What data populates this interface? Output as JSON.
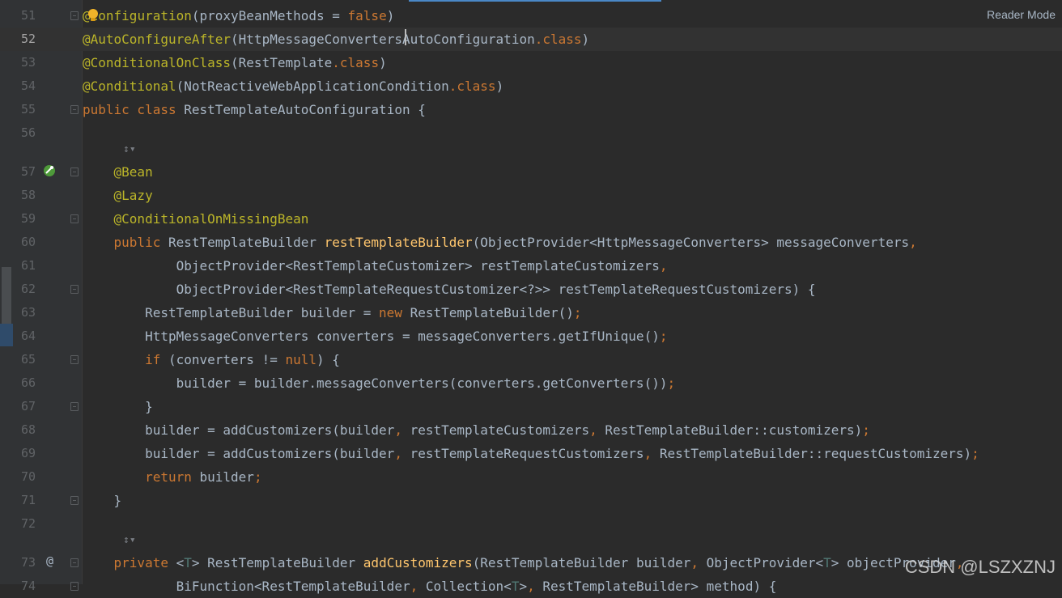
{
  "toolbar": {
    "reader_mode": "Reader Mode"
  },
  "watermark": "CSDN @LSZXZNJ",
  "inlay_hint": "↕▾",
  "colors": {
    "background": "#2b2b2b",
    "keyword": "#cc7832",
    "annotation": "#bbb529",
    "method_decl": "#ffc66d",
    "text": "#a9b7c6",
    "line_number": "#606366"
  },
  "lines": [
    {
      "num": "51",
      "segments": [
        {
          "t": "@",
          "c": "ann"
        },
        {
          "t": "Configuration",
          "c": "ann"
        },
        {
          "t": "(proxyBeanMethods = "
        },
        {
          "t": "false",
          "c": "kw"
        },
        {
          "t": ")"
        }
      ]
    },
    {
      "num": "52",
      "segments": [
        {
          "t": "@AutoConfigureAfter",
          "c": "ann"
        },
        {
          "t": "(HttpMessageConvertersAutoConfiguration"
        },
        {
          "t": ".",
          "c": "pun"
        },
        {
          "t": "class",
          "c": "kw"
        },
        {
          "t": ")"
        }
      ]
    },
    {
      "num": "53",
      "segments": [
        {
          "t": "@ConditionalOnClass",
          "c": "ann"
        },
        {
          "t": "(RestTemplate"
        },
        {
          "t": ".",
          "c": "pun"
        },
        {
          "t": "class",
          "c": "kw"
        },
        {
          "t": ")"
        }
      ]
    },
    {
      "num": "54",
      "segments": [
        {
          "t": "@Conditional",
          "c": "ann"
        },
        {
          "t": "(NotReactiveWebApplicationCondition"
        },
        {
          "t": ".",
          "c": "pun"
        },
        {
          "t": "class",
          "c": "kw"
        },
        {
          "t": ")"
        }
      ]
    },
    {
      "num": "55",
      "segments": [
        {
          "t": "public class ",
          "c": "kw"
        },
        {
          "t": "RestTemplateAutoConfiguration {"
        }
      ]
    },
    {
      "num": "56",
      "segments": []
    },
    {
      "num": "57",
      "segments": [
        {
          "t": "    "
        },
        {
          "t": "@Bean",
          "c": "ann"
        }
      ]
    },
    {
      "num": "58",
      "segments": [
        {
          "t": "    "
        },
        {
          "t": "@Lazy",
          "c": "ann"
        }
      ]
    },
    {
      "num": "59",
      "segments": [
        {
          "t": "    "
        },
        {
          "t": "@ConditionalOnMissingBean",
          "c": "ann"
        }
      ]
    },
    {
      "num": "60",
      "segments": [
        {
          "t": "    "
        },
        {
          "t": "public ",
          "c": "kw"
        },
        {
          "t": "RestTemplateBuilder "
        },
        {
          "t": "restTemplateBuilder",
          "c": "fn"
        },
        {
          "t": "(ObjectProvider<HttpMessageConverters> messageConverters"
        },
        {
          "t": ",",
          "c": "pun"
        }
      ]
    },
    {
      "num": "61",
      "segments": [
        {
          "t": "            ObjectProvider<RestTemplateCustomizer> restTemplateCustomizers"
        },
        {
          "t": ",",
          "c": "pun"
        }
      ]
    },
    {
      "num": "62",
      "segments": [
        {
          "t": "            ObjectProvider<RestTemplateRequestCustomizer<?>> restTemplateRequestCustomizers) {"
        }
      ]
    },
    {
      "num": "63",
      "segments": [
        {
          "t": "        RestTemplateBuilder builder = "
        },
        {
          "t": "new ",
          "c": "kw"
        },
        {
          "t": "RestTemplateBuilder()"
        },
        {
          "t": ";",
          "c": "pun"
        }
      ]
    },
    {
      "num": "64",
      "segments": [
        {
          "t": "        HttpMessageConverters converters = messageConverters.getIfUnique()"
        },
        {
          "t": ";",
          "c": "pun"
        }
      ]
    },
    {
      "num": "65",
      "segments": [
        {
          "t": "        "
        },
        {
          "t": "if ",
          "c": "kw"
        },
        {
          "t": "(converters != "
        },
        {
          "t": "null",
          "c": "kw"
        },
        {
          "t": ") {"
        }
      ]
    },
    {
      "num": "66",
      "segments": [
        {
          "t": "            builder = builder.messageConverters(converters.getConverters())"
        },
        {
          "t": ";",
          "c": "pun"
        }
      ]
    },
    {
      "num": "67",
      "segments": [
        {
          "t": "        }"
        }
      ]
    },
    {
      "num": "68",
      "segments": [
        {
          "t": "        builder = addCustomizers(builder"
        },
        {
          "t": ", ",
          "c": "pun"
        },
        {
          "t": "restTemplateCustomizers"
        },
        {
          "t": ", ",
          "c": "pun"
        },
        {
          "t": "RestTemplateBuilder::customizers)"
        },
        {
          "t": ";",
          "c": "pun"
        }
      ]
    },
    {
      "num": "69",
      "segments": [
        {
          "t": "        builder = addCustomizers(builder"
        },
        {
          "t": ", ",
          "c": "pun"
        },
        {
          "t": "restTemplateRequestCustomizers"
        },
        {
          "t": ", ",
          "c": "pun"
        },
        {
          "t": "RestTemplateBuilder::requestCustomizers)"
        },
        {
          "t": ";",
          "c": "pun"
        }
      ]
    },
    {
      "num": "70",
      "segments": [
        {
          "t": "        "
        },
        {
          "t": "return ",
          "c": "kw"
        },
        {
          "t": "builder"
        },
        {
          "t": ";",
          "c": "pun"
        }
      ]
    },
    {
      "num": "71",
      "segments": [
        {
          "t": "    }"
        }
      ]
    },
    {
      "num": "72",
      "segments": []
    },
    {
      "num": "73",
      "segments": [
        {
          "t": "    "
        },
        {
          "t": "private ",
          "c": "kw"
        },
        {
          "t": "<"
        },
        {
          "t": "T",
          "c": "tp"
        },
        {
          "t": "> RestTemplateBuilder "
        },
        {
          "t": "addCustomizers",
          "c": "fn"
        },
        {
          "t": "(RestTemplateBuilder builder"
        },
        {
          "t": ", ",
          "c": "pun"
        },
        {
          "t": "ObjectProvider<"
        },
        {
          "t": "T",
          "c": "tp"
        },
        {
          "t": "> objectProvider"
        },
        {
          "t": ",",
          "c": "pun"
        }
      ]
    },
    {
      "num": "74",
      "segments": [
        {
          "t": "            BiFunction<RestTemplateBuilder"
        },
        {
          "t": ", ",
          "c": "pun"
        },
        {
          "t": "Collection<"
        },
        {
          "t": "T",
          "c": "tp"
        },
        {
          "t": ">"
        },
        {
          "t": ", ",
          "c": "pun"
        },
        {
          "t": "RestTemplateBuilder> method) {"
        }
      ]
    }
  ]
}
